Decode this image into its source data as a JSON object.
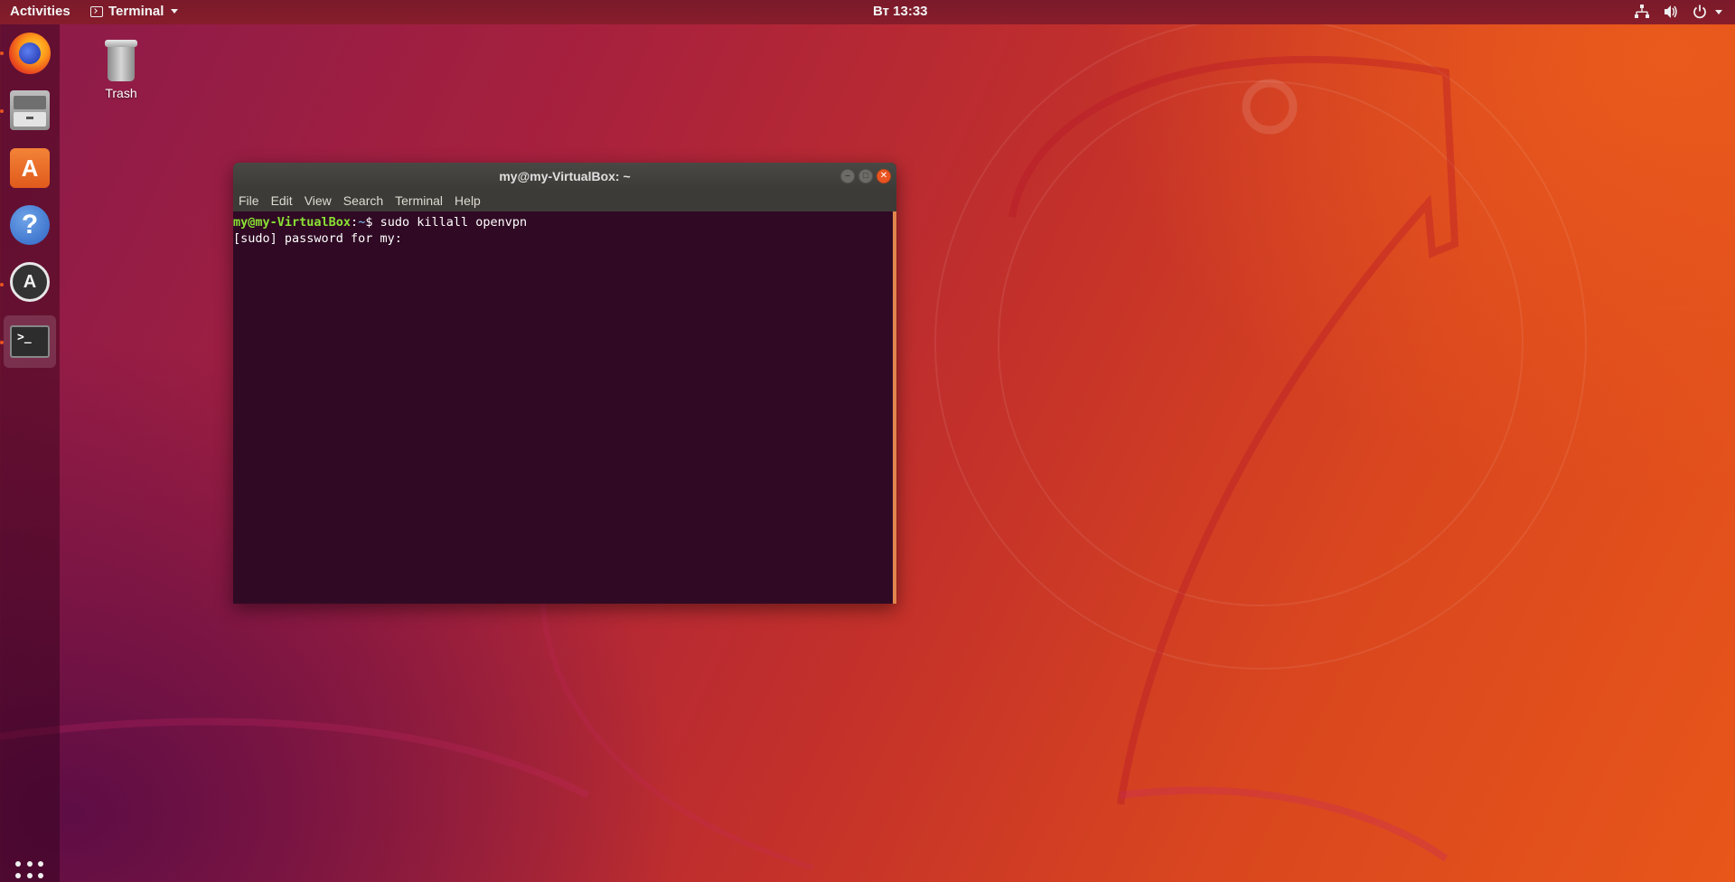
{
  "topbar": {
    "activities": "Activities",
    "app_name": "Terminal",
    "clock": "Вт 13:33",
    "tray_icons": [
      "network-icon",
      "volume-icon",
      "power-icon"
    ]
  },
  "dock": {
    "items": [
      {
        "name": "firefox",
        "icon": "firefox-icon",
        "running": true
      },
      {
        "name": "files",
        "icon": "files-icon",
        "running": true
      },
      {
        "name": "ubuntu-software",
        "icon": "software-icon",
        "running": false
      },
      {
        "name": "help",
        "icon": "help-icon",
        "running": false
      },
      {
        "name": "software-updater",
        "icon": "updater-icon",
        "running": true
      },
      {
        "name": "terminal",
        "icon": "terminal-icon",
        "running": true,
        "active": true
      }
    ],
    "show_apps_icon": "apps-grid-icon",
    "software_glyph": "A",
    "help_glyph": "?",
    "updater_glyph": "A",
    "terminal_glyph": ">_"
  },
  "desktop": {
    "trash_label": "Trash"
  },
  "terminal_window": {
    "title": "my@my-VirtualBox: ~",
    "menu": [
      "File",
      "Edit",
      "View",
      "Search",
      "Terminal",
      "Help"
    ],
    "lines": [
      {
        "user": "my@my-VirtualBox",
        "path": "~",
        "command": "sudo killall openvpn"
      },
      {
        "text": "[sudo] password for my: "
      }
    ]
  },
  "colors": {
    "accent": "#e95420",
    "terminal_bg": "#300a24",
    "prompt_user": "#8ae234",
    "prompt_path": "#729fcf"
  }
}
